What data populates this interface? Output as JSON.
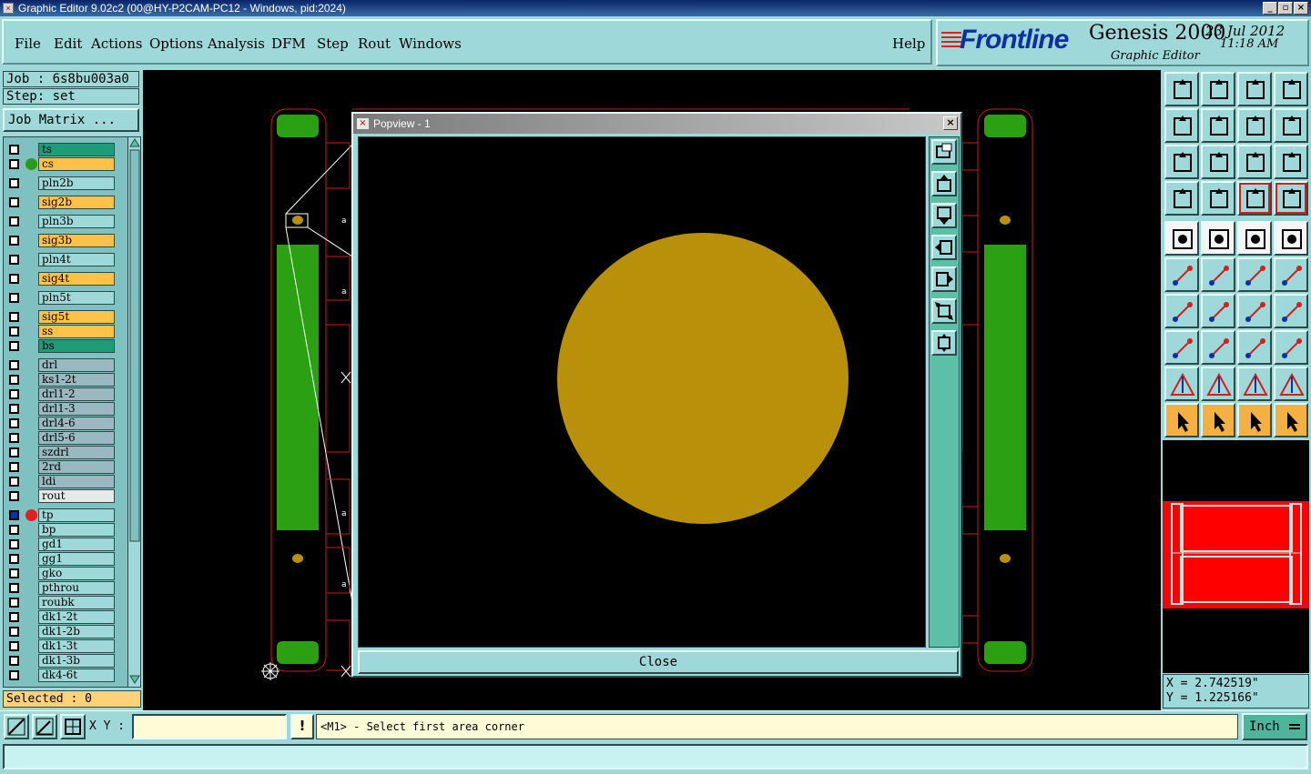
{
  "window": {
    "title": "Graphic Editor 9.02c2 (00@HY-P2CAM-PC12 - Windows, pid:2024)",
    "app_icon": "x-icon"
  },
  "menu": {
    "items": [
      "File",
      "Edit",
      "Actions",
      "Options",
      "Analysis",
      "DFM",
      "Step",
      "Rout",
      "Windows"
    ],
    "help": "Help"
  },
  "brand": {
    "logo": "Frontline",
    "product": "Genesis 2000",
    "subtitle": "Graphic Editor",
    "date": "23 Jul 2012",
    "time": "11:18 AM"
  },
  "job": {
    "job_label": "Job : 6s8bu003a0",
    "step_label": "Step: set",
    "matrix_button": "Job Matrix ..."
  },
  "layers": [
    {
      "name": "ts",
      "color": "#1e9c78",
      "dot": ""
    },
    {
      "name": "cs",
      "color": "#ffc14a",
      "dot": "#2a9a1a"
    },
    {
      "name": "pln2b",
      "color": "#9fd8d8",
      "dot": ""
    },
    {
      "name": "sig2b",
      "color": "#ffc14a",
      "dot": ""
    },
    {
      "name": "pln3b",
      "color": "#9fd8d8",
      "dot": ""
    },
    {
      "name": "sig3b",
      "color": "#ffc14a",
      "dot": ""
    },
    {
      "name": "pln4t",
      "color": "#9fd8d8",
      "dot": ""
    },
    {
      "name": "sig4t",
      "color": "#ffc14a",
      "dot": ""
    },
    {
      "name": "pln5t",
      "color": "#9fd8d8",
      "dot": ""
    },
    {
      "name": "sig5t",
      "color": "#ffc14a",
      "dot": ""
    },
    {
      "name": "ss",
      "color": "#ffc14a",
      "dot": ""
    },
    {
      "name": "bs",
      "color": "#1e9c78",
      "dot": ""
    },
    {
      "name": "drl",
      "color": "#9ab8c0",
      "dot": ""
    },
    {
      "name": "ks1-2t",
      "color": "#9ab8c0",
      "dot": ""
    },
    {
      "name": "drl1-2",
      "color": "#9ab8c0",
      "dot": ""
    },
    {
      "name": "drl1-3",
      "color": "#9ab8c0",
      "dot": ""
    },
    {
      "name": "drl4-6",
      "color": "#9ab8c0",
      "dot": ""
    },
    {
      "name": "drl5-6",
      "color": "#9ab8c0",
      "dot": ""
    },
    {
      "name": "szdrl",
      "color": "#9ab8c0",
      "dot": ""
    },
    {
      "name": "2rd",
      "color": "#9ab8c0",
      "dot": ""
    },
    {
      "name": "ldi",
      "color": "#9ab8c0",
      "dot": ""
    },
    {
      "name": "rout",
      "color": "#e8e8e8",
      "dot": ""
    },
    {
      "name": "tp",
      "color": "#9fd8d8",
      "dot": "#e02020"
    },
    {
      "name": "bp",
      "color": "#9fd8d8",
      "dot": ""
    },
    {
      "name": "gd1",
      "color": "#9fd8d8",
      "dot": ""
    },
    {
      "name": "gg1",
      "color": "#9fd8d8",
      "dot": ""
    },
    {
      "name": "gko",
      "color": "#9fd8d8",
      "dot": ""
    },
    {
      "name": "pthrou",
      "color": "#9fd8d8",
      "dot": ""
    },
    {
      "name": "roubk",
      "color": "#9fd8d8",
      "dot": ""
    },
    {
      "name": "dk1-2t",
      "color": "#9fd8d8",
      "dot": ""
    },
    {
      "name": "dk1-2b",
      "color": "#9fd8d8",
      "dot": ""
    },
    {
      "name": "dk1-3t",
      "color": "#9fd8d8",
      "dot": ""
    },
    {
      "name": "dk1-3b",
      "color": "#9fd8d8",
      "dot": ""
    },
    {
      "name": "dk4-6t",
      "color": "#9fd8d8",
      "dot": ""
    }
  ],
  "selected": "Selected : 0",
  "popview": {
    "title": "Popview - 1",
    "close_label": "Close",
    "close_icon": "x-icon",
    "pad_color": "#b8900a"
  },
  "coords": {
    "x": "X = 2.742519\"",
    "y": "Y = 1.225166\""
  },
  "bottom": {
    "xy_label": "X Y :",
    "xy_value": "",
    "warn": "!",
    "prompt": "<M1> - Select first area corner",
    "unit": "Inch"
  },
  "colors": {
    "board_green": "#2aa012",
    "outline_red": "#d01818",
    "pad_gold": "#b8900a",
    "panel_cyan": "#9fd8d8"
  }
}
